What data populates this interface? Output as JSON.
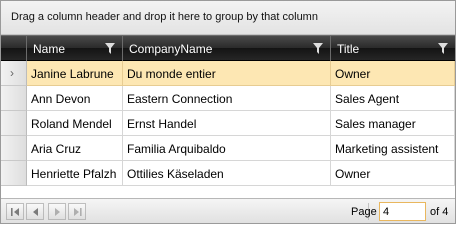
{
  "group_panel": {
    "hint": "Drag a column header and drop it here to group by that column"
  },
  "columns": [
    {
      "label": "Name"
    },
    {
      "label": "CompanyName"
    },
    {
      "label": "Title"
    }
  ],
  "rows": [
    {
      "name": "Janine Labrune",
      "company": "Du monde entier",
      "title": "Owner",
      "selected": true
    },
    {
      "name": "Ann Devon",
      "company": "Eastern Connection",
      "title": "Sales Agent"
    },
    {
      "name": "Roland Mendel",
      "company": "Ernst Handel",
      "title": "Sales manager"
    },
    {
      "name": "Aria Cruz",
      "company": "Familia Arquibaldo",
      "title": "Marketing assistent"
    },
    {
      "name": "Henriette Pfalzh",
      "company": "Ottilies Käseladen",
      "title": "Owner"
    }
  ],
  "row_indicator_icon": "chevron-right-icon",
  "pager": {
    "page_label": "Page",
    "page_value": "4",
    "of_label": "of 4",
    "buttons": [
      "first-page-icon",
      "previous-page-icon",
      "next-page-icon",
      "last-page-icon"
    ]
  },
  "colors": {
    "header_bg": "#1e1e1e",
    "selected_row": "#fde7b3",
    "page_input_border": "#e9b75e"
  }
}
